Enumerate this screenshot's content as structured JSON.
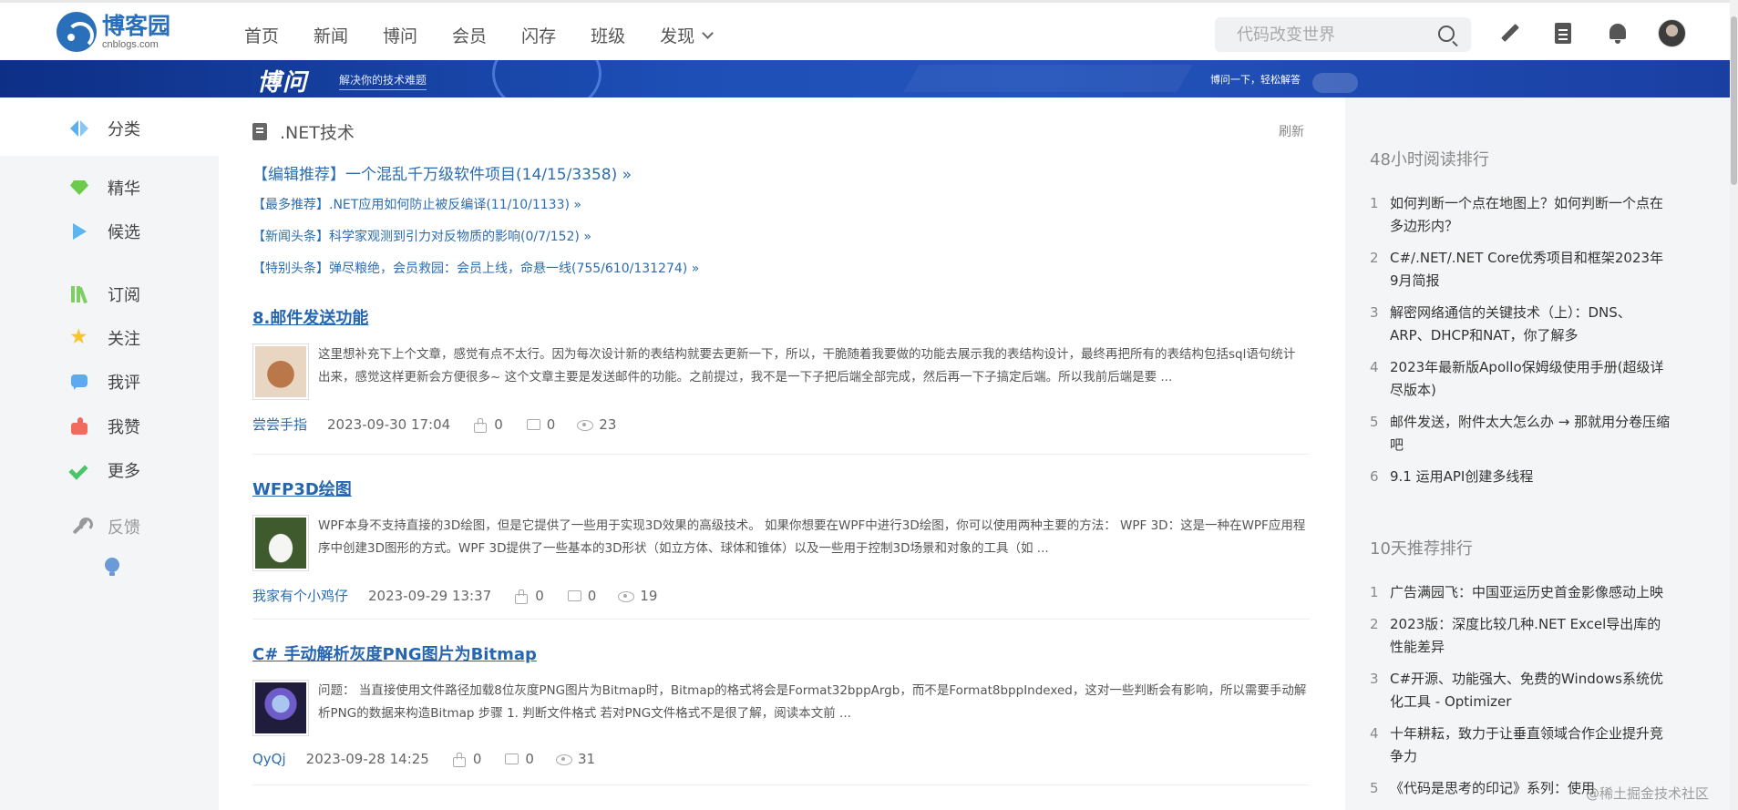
{
  "header": {
    "logo_cn": "博客园",
    "logo_en": "cnblogs.com",
    "nav": [
      "首页",
      "新闻",
      "博问",
      "会员",
      "闪存",
      "班级",
      "发现"
    ],
    "search_placeholder": "代码改变世界",
    "icons": [
      "pencil-icon",
      "document-icon",
      "bell-icon",
      "avatar"
    ]
  },
  "banner": {
    "brand": "博问",
    "tagline": "解决你的技术难题",
    "slogan": "博问一下，轻松解答"
  },
  "sidebar": {
    "category": "分类",
    "items": [
      "精华",
      "候选",
      "订阅",
      "关注",
      "我评",
      "我赞",
      "更多"
    ],
    "feedback": "反馈"
  },
  "main": {
    "section_title": ".NET技术",
    "refresh": "刷新",
    "pinned": [
      "【编辑推荐】一个混乱千万级软件项目(14/15/3358) »",
      "【最多推荐】.NET应用如何防止被反编译(11/10/1133) »",
      "【新闻头条】科学家观测到引力对反物质的影响(0/7/152) »",
      "【特别头条】弹尽粮绝，会员救园：会员上线，命悬一线(755/610/131274) »"
    ],
    "posts": [
      {
        "title": "8.邮件发送功能",
        "excerpt": "这里想补充下上个文章，感觉有点不太行。因为每次设计新的表结构就要去更新一下，所以，干脆随着我要做的功能去展示我的表结构设计，最终再把所有的表结构包括sql语句统计出来，感觉这样更新会方便很多~ 这个文章主要是发送邮件的功能。之前提过，我不是一下子把后端全部完成，然后再一下子搞定后端。所以我前后端是要 ...",
        "author": "尝尝手指",
        "date": "2023-09-30 17:04",
        "likes": "0",
        "comments": "0",
        "views": "23"
      },
      {
        "title": "WFP3D绘图",
        "excerpt": "WPF本身不支持直接的3D绘图，但是它提供了一些用于实现3D效果的高级技术。 如果你想要在WPF中进行3D绘图，你可以使用两种主要的方法： WPF 3D：这是一种在WPF应用程序中创建3D图形的方式。WPF 3D提供了一些基本的3D形状（如立方体、球体和锥体）以及一些用于控制3D场景和对象的工具（如 ...",
        "author": "我家有个小鸡仔",
        "date": "2023-09-29 13:37",
        "likes": "0",
        "comments": "0",
        "views": "19"
      },
      {
        "title": "C# 手动解析灰度PNG图片为Bitmap",
        "excerpt": "问题： 当直接使用文件路径加载8位灰度PNG图片为Bitmap时，Bitmap的格式将会是Format32bppArgb，而不是Format8bppIndexed，这对一些判断会有影响，所以需要手动解析PNG的数据来构造Bitmap 步骤 1. 判断文件格式 若对PNG文件格式不是很了解，阅读本文前 ...",
        "author": "QyQj",
        "date": "2023-09-28 14:25",
        "likes": "0",
        "comments": "0",
        "views": "31"
      }
    ]
  },
  "right": {
    "rank48_title": "48小时阅读排行",
    "rank48": [
      "如何判断一个点在地图上？如何判断一个点在多边形内？",
      "C#/.NET/.NET Core优秀项目和框架2023年9月简报",
      "解密网络通信的关键技术（上）：DNS、ARP、DHCP和NAT，你了解多",
      "2023年最新版Apollo保姆级使用手册(超级详尽版本)",
      "邮件发送，附件太大怎么办 → 那就用分卷压缩吧",
      "9.1 运用API创建多线程"
    ],
    "rank10_title": "10天推荐排行",
    "rank10": [
      "广告满园飞：中国亚运历史首金影像感动上映",
      "2023版：深度比较几种.NET Excel导出库的性能差异",
      "C#开源、功能强大、免费的Windows系统优化工具 - Optimizer",
      "十年耕耘，致力于让垂直领域合作企业提升竞争力",
      "《代码是思考的印记》系列：使用"
    ]
  },
  "watermark": "@稀土掘金技术社区"
}
